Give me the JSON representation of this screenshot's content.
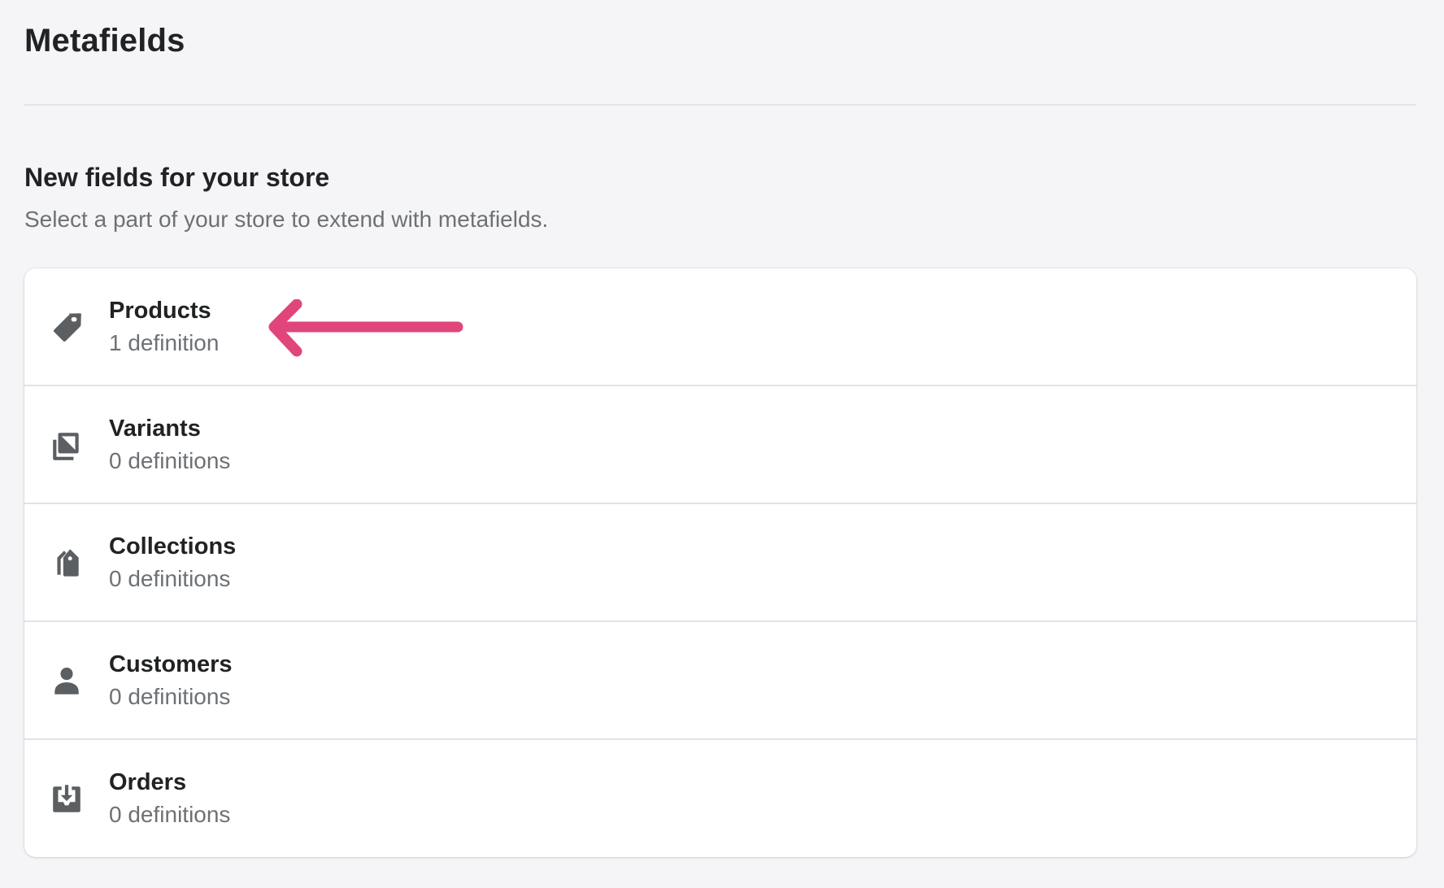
{
  "page": {
    "title": "Metafields"
  },
  "section": {
    "heading": "New fields for your store",
    "subheading": "Select a part of your store to extend with metafields."
  },
  "items": [
    {
      "title": "Products",
      "count": "1 definition",
      "icon": "tag-icon"
    },
    {
      "title": "Variants",
      "count": "0 definitions",
      "icon": "variants-icon"
    },
    {
      "title": "Collections",
      "count": "0 definitions",
      "icon": "collections-icon"
    },
    {
      "title": "Customers",
      "count": "0 definitions",
      "icon": "person-icon"
    },
    {
      "title": "Orders",
      "count": "0 definitions",
      "icon": "inbox-download-icon"
    }
  ],
  "annotation": {
    "icon": "arrow-left-icon",
    "color": "#e0467b"
  },
  "colors": {
    "background": "#f5f5f8",
    "card": "#ffffff",
    "icon": "#5c5f62",
    "text_primary": "#202223",
    "text_secondary": "#6d7175"
  }
}
